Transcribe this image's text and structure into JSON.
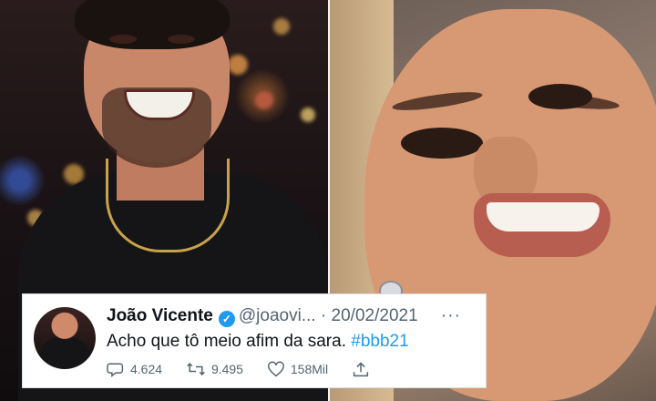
{
  "tweet": {
    "display_name": "João Vicente",
    "verified_glyph": "✓",
    "handle": "@joaovi...",
    "separator": "·",
    "date": "20/02/2021",
    "more": "···",
    "text": "Acho que tô meio afim da sara. ",
    "hashtag": "#bbb21",
    "replies": "4.624",
    "retweets": "9.495",
    "likes": "158Mil"
  },
  "icons": {
    "verified": "verified-badge-icon",
    "reply": "reply-icon",
    "retweet": "retweet-icon",
    "like": "heart-icon",
    "share": "share-icon",
    "more": "more-icon"
  },
  "colors": {
    "accent": "#1d9bf0",
    "text": "#0f1419",
    "secondary": "#536471"
  }
}
